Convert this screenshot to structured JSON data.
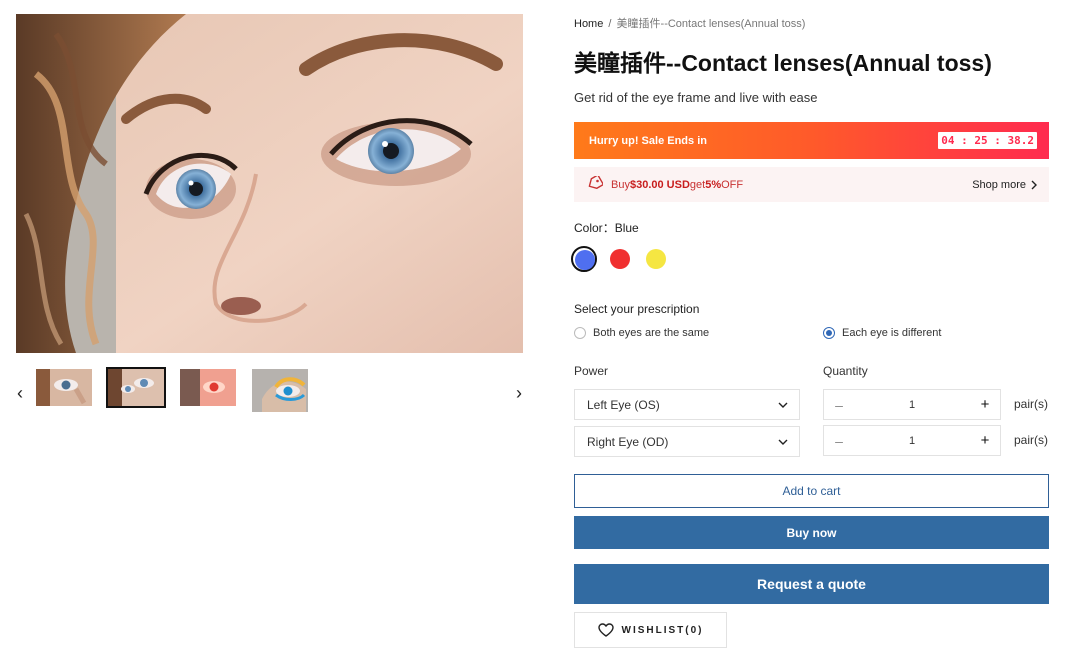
{
  "breadcrumb": {
    "home": "Home",
    "separator": "/",
    "current": "美瞳插件--Contact lenses(Annual toss)"
  },
  "product": {
    "title": "美瞳插件--Contact lenses(Annual toss)",
    "subtitle": "Get rid of the eye frame and live with ease"
  },
  "sale": {
    "label": "Hurry up! Sale Ends in",
    "timer": "04 : 25 : 38.2"
  },
  "promo": {
    "prefix": "Buy ",
    "amount": "$30.00 USD",
    "mid": " get ",
    "percent": "5%",
    "suffix": " OFF",
    "shop_more": "Shop more",
    "icon": "tag-icon"
  },
  "color": {
    "label": "Color",
    "separator": "：",
    "selected": "Blue",
    "swatches": [
      {
        "name": "Blue",
        "hex": "#4f6ff0"
      },
      {
        "name": "Red",
        "hex": "#f03030"
      },
      {
        "name": "Yellow",
        "hex": "#f5e642"
      }
    ]
  },
  "prescription": {
    "label": "Select your prescription",
    "options": [
      "Both eyes are the same",
      "Each eye is different"
    ],
    "selected": "Each eye is different"
  },
  "power": {
    "label": "Power",
    "left_eye": "Left Eye (OS)",
    "right_eye": "Right Eye (OD)"
  },
  "quantity": {
    "label": "Quantity",
    "left_value": "1",
    "right_value": "1",
    "minus": "–",
    "plus": "+",
    "unit": "pair(s)"
  },
  "actions": {
    "add_to_cart": "Add to cart",
    "buy_now": "Buy now",
    "request_quote": "Request a quote",
    "wishlist": "WISHLIST(0)"
  },
  "gallery": {
    "prev_arrow": "‹",
    "next_arrow": "›",
    "active_thumb": 2
  },
  "colors": {
    "accent": "#326ba2",
    "sale_start": "#ff7a1a",
    "sale_end": "#ff2b4f",
    "promo_bg": "#fcf3f3",
    "promo_text": "#c81e1e"
  }
}
